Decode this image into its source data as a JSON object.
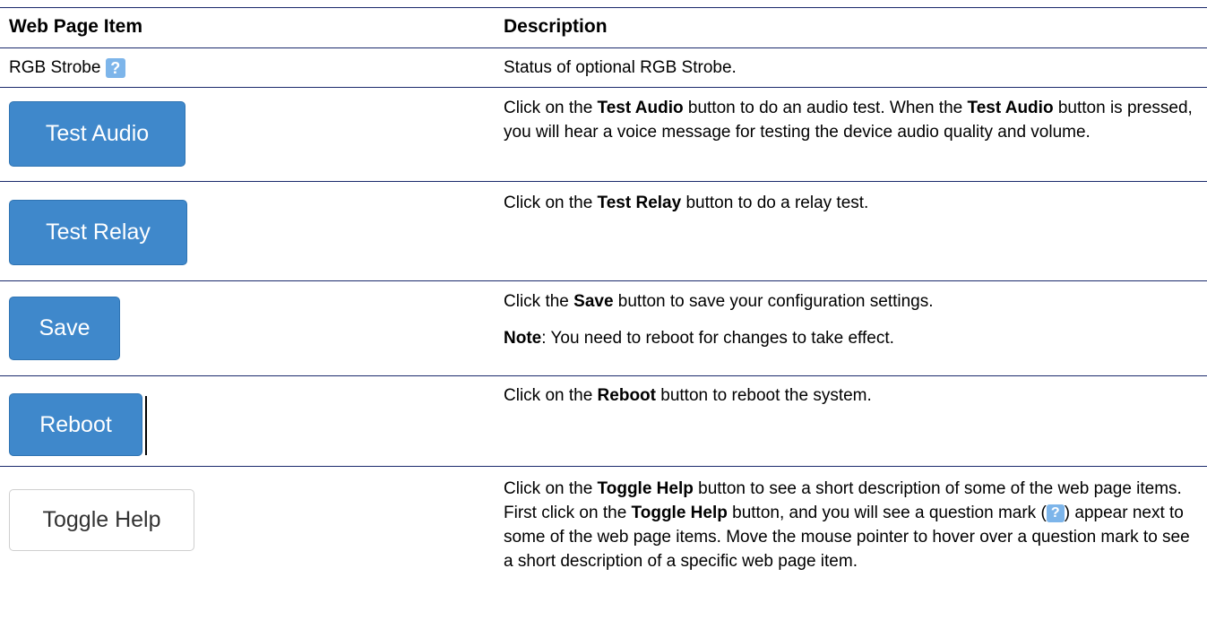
{
  "header": {
    "col1": "Web Page Item",
    "col2": "Description"
  },
  "rows": [
    {
      "item_label": "RGB Strobe",
      "item_icon": "question-mark-icon",
      "desc": [
        [
          "Status of optional RGB Strobe."
        ]
      ]
    },
    {
      "button": "Test Audio",
      "desc": [
        [
          "Click on the ",
          "Test Audio",
          " button to do an audio test. When the ",
          "Test Audio",
          " button is pressed, you will hear a voice message for testing the device audio quality and volume."
        ]
      ]
    },
    {
      "button": "Test Relay",
      "desc": [
        [
          "Click on the ",
          "Test Relay",
          " button to do a relay test."
        ]
      ]
    },
    {
      "button": "Save",
      "desc": [
        [
          "Click the ",
          "Save",
          " button to save your configuration settings."
        ],
        [
          "Note",
          ": You need to reboot for changes to take effect."
        ]
      ]
    },
    {
      "button": "Reboot",
      "desc": [
        [
          "Click on the ",
          "Reboot",
          " button to reboot the system."
        ]
      ]
    },
    {
      "button": "Toggle Help",
      "desc": [
        [
          "Click on the ",
          "Toggle Help",
          " button to see a short description of some of the web page items. First click on the ",
          "Toggle Help",
          " button, and you will see a question mark ("
        ],
        [
          "",
          "",
          ") appear next to some of the web page items. Move the mouse pointer to hover over a question mark to see a short description of a specific web page item."
        ]
      ]
    }
  ],
  "qmark_glyph": "?"
}
